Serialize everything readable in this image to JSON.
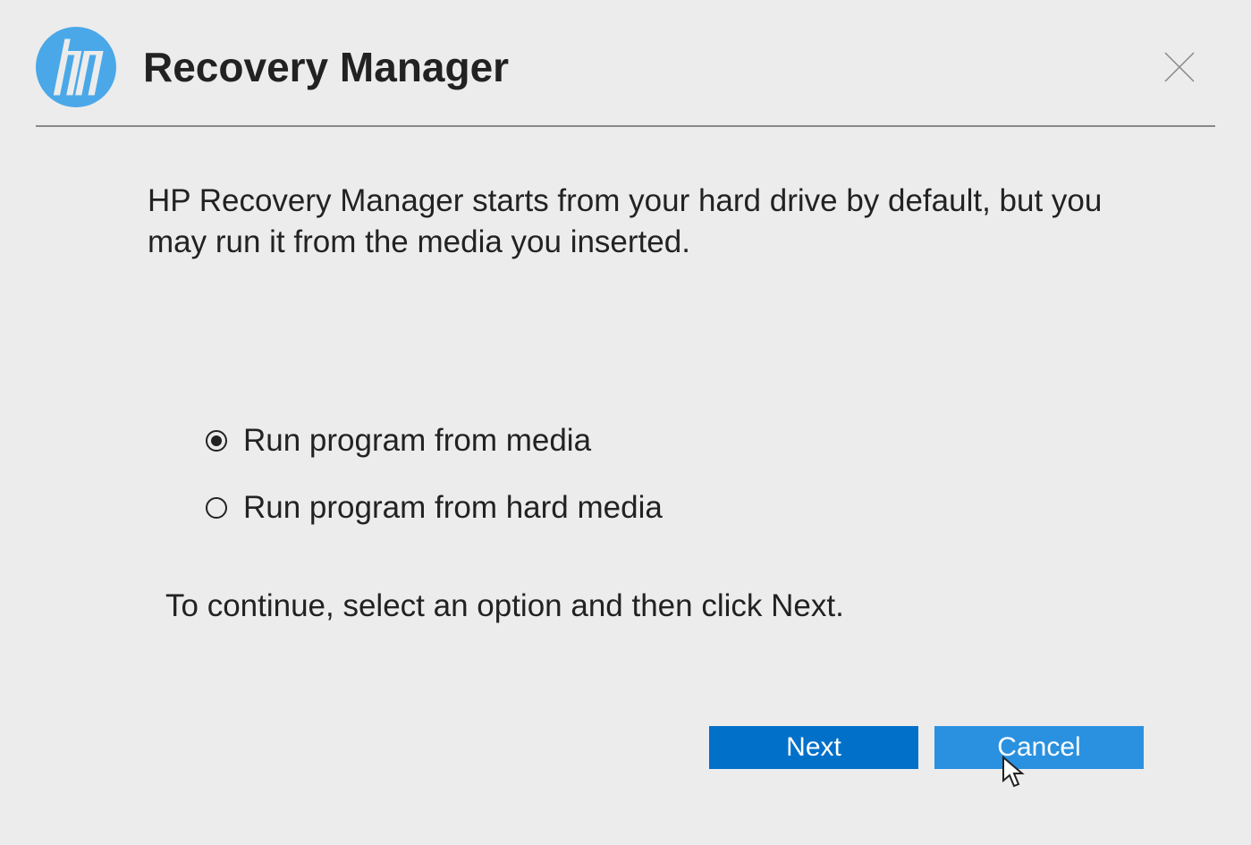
{
  "header": {
    "title": "Recovery Manager"
  },
  "content": {
    "description": "HP Recovery Manager starts from your hard drive by default, but you may run it from the media you inserted.",
    "instruction": "To continue, select an option and then click Next."
  },
  "options": [
    {
      "label": "Run program from media",
      "selected": true
    },
    {
      "label": "Run program from hard media",
      "selected": false
    }
  ],
  "buttons": {
    "next": "Next",
    "cancel": "Cancel"
  }
}
